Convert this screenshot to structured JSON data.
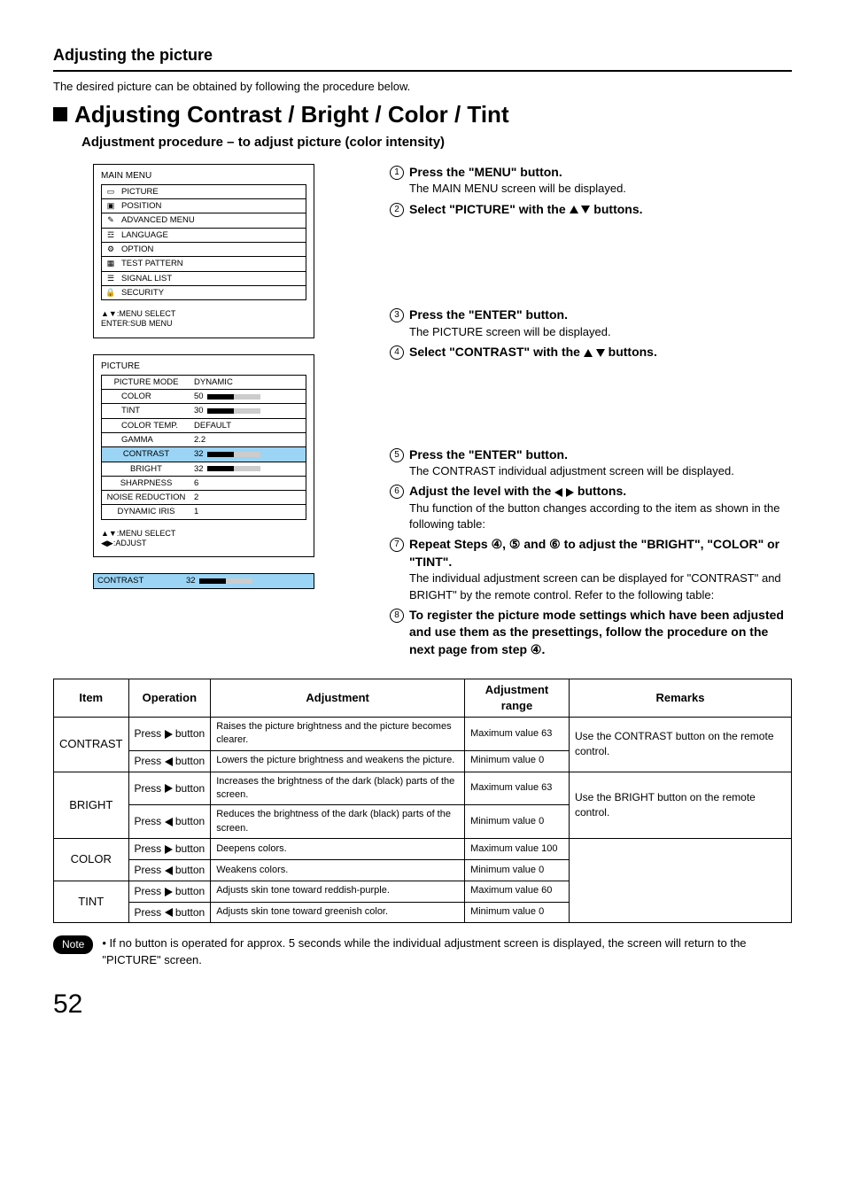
{
  "section_title": "Adjusting the picture",
  "intro": "The desired picture can be obtained by following the procedure below.",
  "main_title": "Adjusting Contrast / Bright / Color / Tint",
  "sub_title": "Adjustment procedure – to adjust picture (color intensity)",
  "main_menu": {
    "title": "MAIN MENU",
    "items": [
      "PICTURE",
      "POSITION",
      "ADVANCED MENU",
      "LANGUAGE",
      "OPTION",
      "TEST PATTERN",
      "SIGNAL LIST",
      "SECURITY"
    ],
    "hint1": "▲▼:MENU SELECT",
    "hint2": "ENTER:SUB MENU"
  },
  "picture_menu": {
    "title": "PICTURE",
    "rows": [
      {
        "label": "PICTURE MODE",
        "value": "DYNAMIC",
        "indent": false,
        "bar": null,
        "hl": false
      },
      {
        "label": "COLOR",
        "value": "50",
        "indent": true,
        "bar": {
          "fill": 50,
          "max": 100
        },
        "hl": false
      },
      {
        "label": "TINT",
        "value": "30",
        "indent": true,
        "bar": {
          "fill": 30,
          "max": 60
        },
        "hl": false
      },
      {
        "label": "COLOR TEMP.",
        "value": "DEFAULT",
        "indent": true,
        "bar": null,
        "hl": false
      },
      {
        "label": "GAMMA",
        "value": "2.2",
        "indent": true,
        "bar": null,
        "hl": false
      },
      {
        "label": "CONTRAST",
        "value": "32",
        "indent": false,
        "bar": {
          "fill": 32,
          "max": 63
        },
        "hl": true
      },
      {
        "label": "BRIGHT",
        "value": "32",
        "indent": false,
        "bar": {
          "fill": 32,
          "max": 63
        },
        "hl": false
      },
      {
        "label": "SHARPNESS",
        "value": "6",
        "indent": false,
        "bar": null,
        "hl": false
      },
      {
        "label": "NOISE REDUCTION",
        "value": "2",
        "indent": false,
        "bar": null,
        "hl": false
      },
      {
        "label": "DYNAMIC IRIS",
        "value": "1",
        "indent": false,
        "bar": null,
        "hl": false
      }
    ],
    "hint1": "▲▼:MENU SELECT",
    "hint2": "◀▶:ADJUST"
  },
  "contrast_bar": {
    "label": "CONTRAST",
    "value": "32",
    "fill": 32,
    "max": 63
  },
  "steps": [
    {
      "n": "1",
      "head": "Press the \"MENU\" button.",
      "text": "The MAIN MENU screen will be displayed."
    },
    {
      "n": "2",
      "head_pre": "Select \"PICTURE\" with the ",
      "head_post": " buttons.",
      "arrows": "ud",
      "text": ""
    },
    {
      "n": "3",
      "head": "Press the \"ENTER\" button.",
      "text": "The PICTURE screen will be displayed."
    },
    {
      "n": "4",
      "head_pre": "Select \"CONTRAST\" with the ",
      "head_post": " buttons.",
      "arrows": "ud",
      "text": ""
    },
    {
      "n": "5",
      "head": "Press the \"ENTER\" button.",
      "text": "The CONTRAST individual adjustment screen will be displayed."
    },
    {
      "n": "6",
      "head_pre": "Adjust the level with the ",
      "head_post": " buttons.",
      "arrows": "lr",
      "text": "Thu function of the button changes according to the item as shown in the following table:"
    },
    {
      "n": "7",
      "head": "Repeat Steps ④, ⑤ and ⑥ to adjust the \"BRIGHT\", \"COLOR\" or \"TINT\".",
      "text": "The individual adjustment screen can be displayed for \"CONTRAST\" and BRIGHT\" by the remote control.  Refer to the following table:"
    },
    {
      "n": "8",
      "head": "To register the picture mode settings which have been adjusted and use them as the presettings, follow the procedure on the next page from step ④.",
      "text": ""
    }
  ],
  "table": {
    "headers": [
      "Item",
      "Operation",
      "Adjustment",
      "Adjustment range",
      "Remarks"
    ],
    "rows": [
      {
        "item": "CONTRAST",
        "ops": [
          {
            "dir": "right",
            "adj": "Raises the picture brightness and the picture becomes clearer.",
            "range": "Maximum value 63"
          },
          {
            "dir": "left",
            "adj": "Lowers the picture brightness and weakens the picture.",
            "range": "Minimum value 0"
          }
        ],
        "remark": "Use the CONTRAST button on the remote control."
      },
      {
        "item": "BRIGHT",
        "ops": [
          {
            "dir": "right",
            "adj": "Increases the brightness of the dark (black) parts of the screen.",
            "range": "Maximum value 63"
          },
          {
            "dir": "left",
            "adj": "Reduces the brightness of the dark (black) parts of the screen.",
            "range": "Minimum value 0"
          }
        ],
        "remark": "Use the BRIGHT button on the remote control."
      },
      {
        "item": "COLOR",
        "ops": [
          {
            "dir": "right",
            "adj": "Deepens colors.",
            "range": "Maximum value 100"
          },
          {
            "dir": "left",
            "adj": "Weakens colors.",
            "range": "Minimum value 0"
          }
        ],
        "remark": ""
      },
      {
        "item": "TINT",
        "ops": [
          {
            "dir": "right",
            "adj": "Adjusts skin tone toward reddish-purple.",
            "range": "Maximum value 60"
          },
          {
            "dir": "left",
            "adj": "Adjusts skin tone toward greenish color.",
            "range": "Minimum value 0"
          }
        ],
        "remark": ""
      }
    ],
    "op_prefix": "Press ",
    "op_suffix": " button"
  },
  "note": {
    "label": "Note",
    "text": "• If no button is operated for approx. 5 seconds while the individual adjustment screen is displayed, the screen will return to the \"PICTURE\" screen."
  },
  "page_num": "52"
}
